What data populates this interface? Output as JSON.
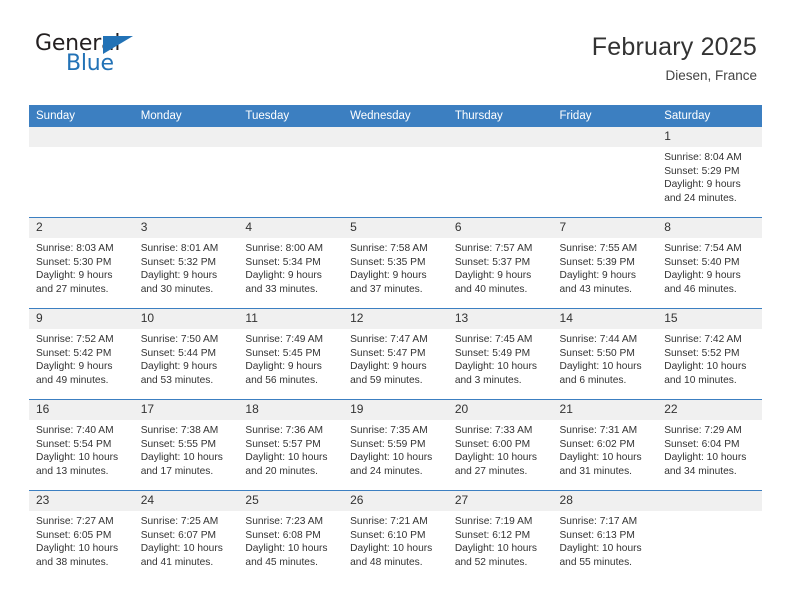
{
  "brand": {
    "name_top": "General",
    "name_bottom": "Blue",
    "triangle_icon": "triangle-icon",
    "color_dark": "#231f20",
    "color_blue": "#2272b6"
  },
  "header": {
    "title": "February 2025",
    "subtitle": "Diesen, France"
  },
  "theme": {
    "header_blue": "#3c7fc1",
    "daynum_band": "#f0f0f0",
    "text": "#333333"
  },
  "calendar": {
    "weekday_headers": [
      "Sunday",
      "Monday",
      "Tuesday",
      "Wednesday",
      "Thursday",
      "Friday",
      "Saturday"
    ],
    "weeks": [
      [
        {
          "day": "",
          "empty": true
        },
        {
          "day": "",
          "empty": true
        },
        {
          "day": "",
          "empty": true
        },
        {
          "day": "",
          "empty": true
        },
        {
          "day": "",
          "empty": true
        },
        {
          "day": "",
          "empty": true
        },
        {
          "day": "1",
          "sunrise": "Sunrise: 8:04 AM",
          "sunset": "Sunset: 5:29 PM",
          "daylight_1": "Daylight: 9 hours",
          "daylight_2": "and 24 minutes."
        }
      ],
      [
        {
          "day": "2",
          "sunrise": "Sunrise: 8:03 AM",
          "sunset": "Sunset: 5:30 PM",
          "daylight_1": "Daylight: 9 hours",
          "daylight_2": "and 27 minutes."
        },
        {
          "day": "3",
          "sunrise": "Sunrise: 8:01 AM",
          "sunset": "Sunset: 5:32 PM",
          "daylight_1": "Daylight: 9 hours",
          "daylight_2": "and 30 minutes."
        },
        {
          "day": "4",
          "sunrise": "Sunrise: 8:00 AM",
          "sunset": "Sunset: 5:34 PM",
          "daylight_1": "Daylight: 9 hours",
          "daylight_2": "and 33 minutes."
        },
        {
          "day": "5",
          "sunrise": "Sunrise: 7:58 AM",
          "sunset": "Sunset: 5:35 PM",
          "daylight_1": "Daylight: 9 hours",
          "daylight_2": "and 37 minutes."
        },
        {
          "day": "6",
          "sunrise": "Sunrise: 7:57 AM",
          "sunset": "Sunset: 5:37 PM",
          "daylight_1": "Daylight: 9 hours",
          "daylight_2": "and 40 minutes."
        },
        {
          "day": "7",
          "sunrise": "Sunrise: 7:55 AM",
          "sunset": "Sunset: 5:39 PM",
          "daylight_1": "Daylight: 9 hours",
          "daylight_2": "and 43 minutes."
        },
        {
          "day": "8",
          "sunrise": "Sunrise: 7:54 AM",
          "sunset": "Sunset: 5:40 PM",
          "daylight_1": "Daylight: 9 hours",
          "daylight_2": "and 46 minutes."
        }
      ],
      [
        {
          "day": "9",
          "sunrise": "Sunrise: 7:52 AM",
          "sunset": "Sunset: 5:42 PM",
          "daylight_1": "Daylight: 9 hours",
          "daylight_2": "and 49 minutes."
        },
        {
          "day": "10",
          "sunrise": "Sunrise: 7:50 AM",
          "sunset": "Sunset: 5:44 PM",
          "daylight_1": "Daylight: 9 hours",
          "daylight_2": "and 53 minutes."
        },
        {
          "day": "11",
          "sunrise": "Sunrise: 7:49 AM",
          "sunset": "Sunset: 5:45 PM",
          "daylight_1": "Daylight: 9 hours",
          "daylight_2": "and 56 minutes."
        },
        {
          "day": "12",
          "sunrise": "Sunrise: 7:47 AM",
          "sunset": "Sunset: 5:47 PM",
          "daylight_1": "Daylight: 9 hours",
          "daylight_2": "and 59 minutes."
        },
        {
          "day": "13",
          "sunrise": "Sunrise: 7:45 AM",
          "sunset": "Sunset: 5:49 PM",
          "daylight_1": "Daylight: 10 hours",
          "daylight_2": "and 3 minutes."
        },
        {
          "day": "14",
          "sunrise": "Sunrise: 7:44 AM",
          "sunset": "Sunset: 5:50 PM",
          "daylight_1": "Daylight: 10 hours",
          "daylight_2": "and 6 minutes."
        },
        {
          "day": "15",
          "sunrise": "Sunrise: 7:42 AM",
          "sunset": "Sunset: 5:52 PM",
          "daylight_1": "Daylight: 10 hours",
          "daylight_2": "and 10 minutes."
        }
      ],
      [
        {
          "day": "16",
          "sunrise": "Sunrise: 7:40 AM",
          "sunset": "Sunset: 5:54 PM",
          "daylight_1": "Daylight: 10 hours",
          "daylight_2": "and 13 minutes."
        },
        {
          "day": "17",
          "sunrise": "Sunrise: 7:38 AM",
          "sunset": "Sunset: 5:55 PM",
          "daylight_1": "Daylight: 10 hours",
          "daylight_2": "and 17 minutes."
        },
        {
          "day": "18",
          "sunrise": "Sunrise: 7:36 AM",
          "sunset": "Sunset: 5:57 PM",
          "daylight_1": "Daylight: 10 hours",
          "daylight_2": "and 20 minutes."
        },
        {
          "day": "19",
          "sunrise": "Sunrise: 7:35 AM",
          "sunset": "Sunset: 5:59 PM",
          "daylight_1": "Daylight: 10 hours",
          "daylight_2": "and 24 minutes."
        },
        {
          "day": "20",
          "sunrise": "Sunrise: 7:33 AM",
          "sunset": "Sunset: 6:00 PM",
          "daylight_1": "Daylight: 10 hours",
          "daylight_2": "and 27 minutes."
        },
        {
          "day": "21",
          "sunrise": "Sunrise: 7:31 AM",
          "sunset": "Sunset: 6:02 PM",
          "daylight_1": "Daylight: 10 hours",
          "daylight_2": "and 31 minutes."
        },
        {
          "day": "22",
          "sunrise": "Sunrise: 7:29 AM",
          "sunset": "Sunset: 6:04 PM",
          "daylight_1": "Daylight: 10 hours",
          "daylight_2": "and 34 minutes."
        }
      ],
      [
        {
          "day": "23",
          "sunrise": "Sunrise: 7:27 AM",
          "sunset": "Sunset: 6:05 PM",
          "daylight_1": "Daylight: 10 hours",
          "daylight_2": "and 38 minutes."
        },
        {
          "day": "24",
          "sunrise": "Sunrise: 7:25 AM",
          "sunset": "Sunset: 6:07 PM",
          "daylight_1": "Daylight: 10 hours",
          "daylight_2": "and 41 minutes."
        },
        {
          "day": "25",
          "sunrise": "Sunrise: 7:23 AM",
          "sunset": "Sunset: 6:08 PM",
          "daylight_1": "Daylight: 10 hours",
          "daylight_2": "and 45 minutes."
        },
        {
          "day": "26",
          "sunrise": "Sunrise: 7:21 AM",
          "sunset": "Sunset: 6:10 PM",
          "daylight_1": "Daylight: 10 hours",
          "daylight_2": "and 48 minutes."
        },
        {
          "day": "27",
          "sunrise": "Sunrise: 7:19 AM",
          "sunset": "Sunset: 6:12 PM",
          "daylight_1": "Daylight: 10 hours",
          "daylight_2": "and 52 minutes."
        },
        {
          "day": "28",
          "sunrise": "Sunrise: 7:17 AM",
          "sunset": "Sunset: 6:13 PM",
          "daylight_1": "Daylight: 10 hours",
          "daylight_2": "and 55 minutes."
        },
        {
          "day": "",
          "empty": true
        }
      ]
    ]
  }
}
